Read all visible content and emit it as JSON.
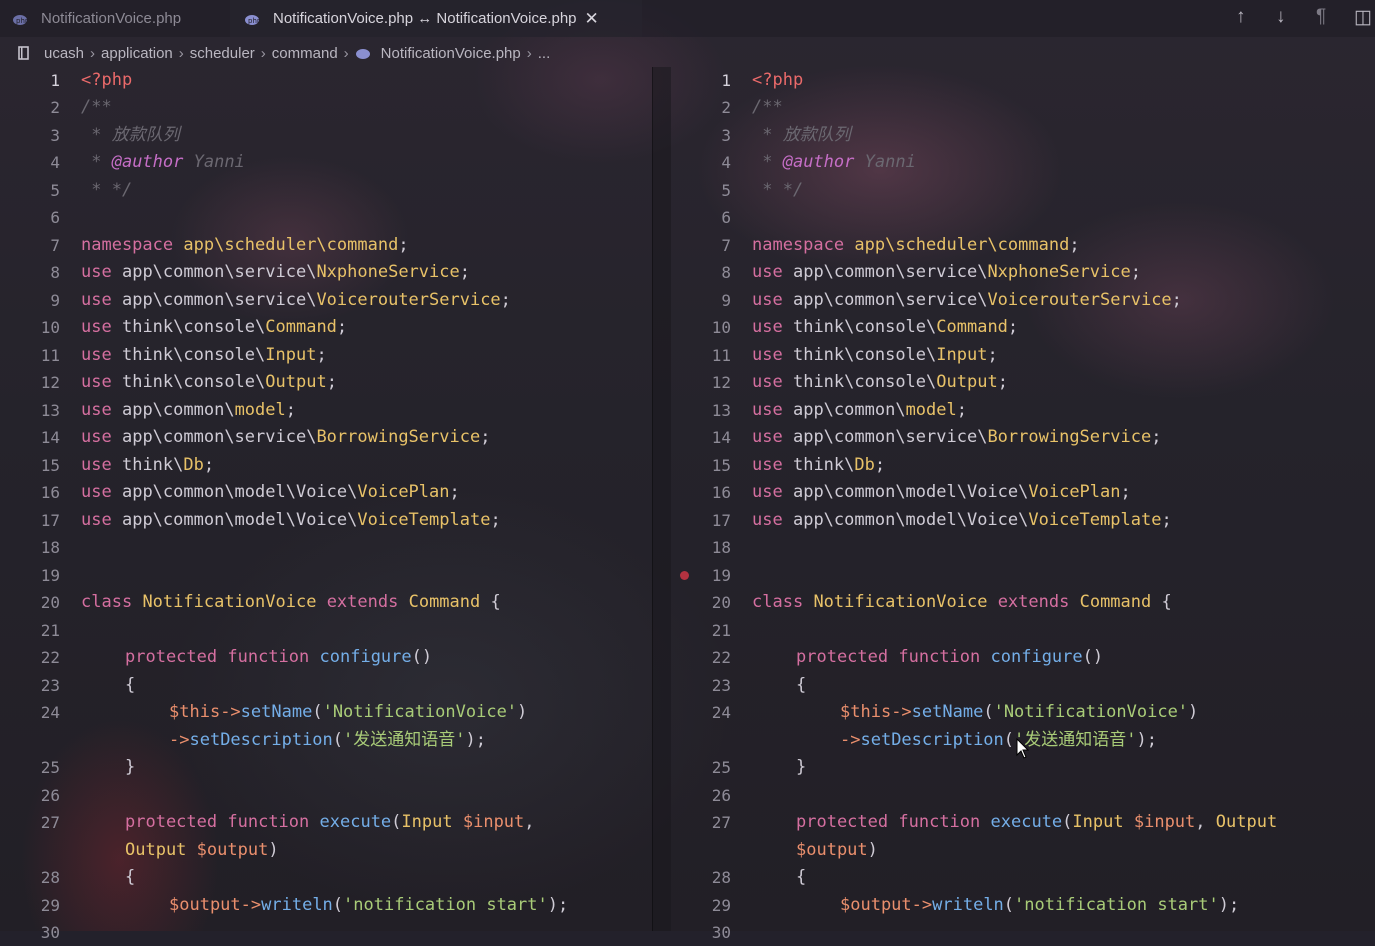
{
  "tabs": [
    {
      "label": "NotificationVoice.php",
      "active": false
    },
    {
      "label": "NotificationVoice.php ↔ NotificationVoice.php",
      "active": true
    }
  ],
  "toolbar": {
    "up": "↑",
    "down": "↓",
    "pilcrow": "¶",
    "split": "◫"
  },
  "breadcrumb": {
    "items": [
      "ucash",
      "application",
      "scheduler",
      "command"
    ],
    "file": "NotificationVoice.php",
    "more": "..."
  },
  "colors": {
    "keyword": "#d56fa0",
    "function": "#74aee8",
    "class": "#e8c268",
    "string": "#a9cc78",
    "variable": "#ea8f6d",
    "breakpoint": "#b23240"
  },
  "code": {
    "l1": "<?php",
    "l2": "/**",
    "l3": " * 放款队列",
    "l4a": " * ",
    "l4b": "@author",
    "l4c": " Yanni",
    "l5": " * */",
    "ns_kw": "namespace",
    "ns_path": "app\\scheduler\\command",
    "semi": ";",
    "use": "use",
    "u8p": "app\\common\\service\\",
    "u8c": "NxphoneService",
    "u9p": "app\\common\\service\\",
    "u9c": "VoicerouterService",
    "u10p": "think\\console\\",
    "u10c": "Command",
    "u11p": "think\\console\\",
    "u11c": "Input",
    "u12p": "think\\console\\",
    "u12c": "Output",
    "u13p": "app\\common\\",
    "u13c": "model",
    "u14p": "app\\common\\service\\",
    "u14c": "BorrowingService",
    "u15p": "think\\",
    "u15c": "Db",
    "u16p": "app\\common\\model\\Voice\\",
    "u16c": "VoicePlan",
    "u17p": "app\\common\\model\\Voice\\",
    "u17c": "VoiceTemplate",
    "class_kw": "class",
    "class_name": "NotificationVoice",
    "extends_kw": "extends",
    "parent": "Command",
    "brace_open": "{",
    "protected": "protected",
    "function": "function",
    "configure": "configure",
    "parens": "()",
    "this": "$this",
    "arrow": "->",
    "setName": "setName",
    "setName_arg": "'NotificationVoice'",
    "close_paren": ")",
    "setDescription": "setDescription",
    "setDescription_arg": "'发送通知语音'",
    "close_stmt": ");",
    "brace_close": "}",
    "execute": "execute",
    "input_type": "Input",
    "input_var": "$input",
    "comma": ",",
    "output_type": "Output",
    "output_var": "$output",
    "writeln_obj": "$output",
    "writeln": "writeln",
    "writeln_arg": "'notification start'"
  },
  "line_numbers": [
    "1",
    "2",
    "3",
    "4",
    "5",
    "6",
    "7",
    "8",
    "9",
    "10",
    "11",
    "12",
    "13",
    "14",
    "15",
    "16",
    "17",
    "18",
    "19",
    "20",
    "21",
    "22",
    "23",
    "24",
    "25",
    "26",
    "27",
    "28",
    "29",
    "30"
  ]
}
